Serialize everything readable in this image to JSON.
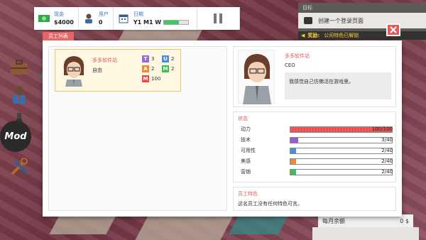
{
  "hud": {
    "money": {
      "label": "现金",
      "value": "$4000",
      "icon": "cash-icon"
    },
    "users": {
      "label": "用户",
      "value": "0",
      "icon": "person-icon"
    },
    "date": {
      "label": "日期",
      "value": "Y1 M1 W",
      "progress": 0.6,
      "icon": "calendar-icon"
    },
    "pause_icon": "pause-icon"
  },
  "goal": {
    "title": "目标",
    "task": "创建一个登录页面",
    "reward_label": "奖励:",
    "reward_text": "公司特色已解锁"
  },
  "tools": [
    "briefcase-icon",
    "employee-icon",
    "flask-icon",
    "wrench-icon"
  ],
  "mod_label": "Mod",
  "monthly": {
    "label": "每月余额",
    "value": "0 $"
  },
  "dialog": {
    "tab_label": "员工列表",
    "close_icon": "close-icon",
    "employee": {
      "name": "多多软件站",
      "status": "自由",
      "skills": [
        {
          "letter": "T",
          "value": "3",
          "color": "#9b6bd0"
        },
        {
          "letter": "U",
          "value": "2",
          "color": "#4a8fd6"
        },
        {
          "letter": "A",
          "value": "2",
          "color": "#ef8a3c"
        },
        {
          "letter": "M",
          "value": "2",
          "color": "#3fbf52"
        },
        {
          "letter": "M",
          "value": "100",
          "color": "#e84a4a"
        }
      ]
    },
    "profile": {
      "name": "多多软件站",
      "role": "CEO",
      "quote": "我感觉自己仿佛活在游戏里。"
    },
    "stats_title": "状态",
    "stats": [
      {
        "name": "动力",
        "value": "100/100",
        "fraction": 1.0,
        "color": "#ef5a5a"
      },
      {
        "name": "技术",
        "value": "3/40",
        "fraction": 0.075,
        "color": "#9b5ad0"
      },
      {
        "name": "可用性",
        "value": "2/40",
        "fraction": 0.05,
        "color": "#4a8fd6"
      },
      {
        "name": "美感",
        "value": "2/40",
        "fraction": 0.05,
        "color": "#ef8a3c"
      },
      {
        "name": "营销",
        "value": "2/40",
        "fraction": 0.05,
        "color": "#3fbf52"
      }
    ],
    "traits_title": "员工特色",
    "traits_text": "这名员工没有任何特色可言。"
  }
}
